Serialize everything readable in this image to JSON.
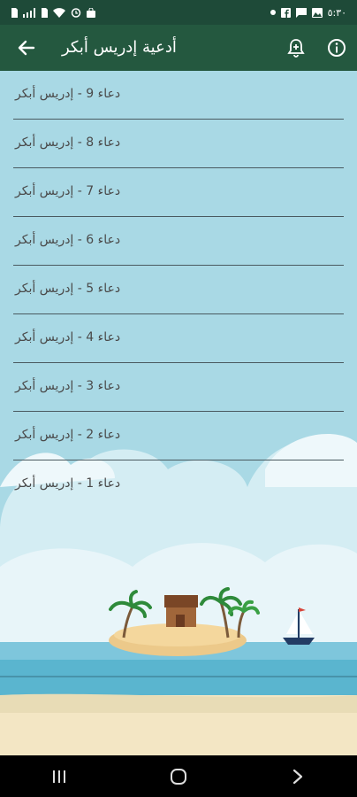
{
  "status_bar": {
    "time": "٥:٣٠",
    "left_icons": [
      "sim-icon",
      "signal-icon",
      "sim-icon",
      "wifi-icon",
      "alarm-icon",
      "shopping-icon"
    ],
    "right_icons": [
      "dot-icon",
      "facebook-icon",
      "message-icon",
      "image-icon"
    ]
  },
  "app_bar": {
    "title": "أدعية إدريس أبكر",
    "back_icon": "arrow-left-icon",
    "notification_icon": "bell-add-icon",
    "info_icon": "info-icon"
  },
  "duas": [
    {
      "label": "دعاء 9 - إدريس أبكر"
    },
    {
      "label": "دعاء 8 - إدريس أبكر"
    },
    {
      "label": "دعاء 7 - إدريس أبكر"
    },
    {
      "label": "دعاء 6 - إدريس أبكر"
    },
    {
      "label": "دعاء 5 - إدريس أبكر"
    },
    {
      "label": "دعاء 4 - إدريس أبكر"
    },
    {
      "label": "دعاء 3 - إدريس أبكر"
    },
    {
      "label": "دعاء 2 - إدريس أبكر"
    },
    {
      "label": "دعاء 1 - إدريس أبكر"
    }
  ],
  "nav_bar": {
    "buttons": [
      "recents-icon",
      "home-icon",
      "back-icon"
    ]
  },
  "colors": {
    "header": "#24583f",
    "status_bar": "#1e4a38",
    "sky": "#a9d9e5",
    "sea": "#5ab5cf",
    "sand": "#f3e6c4"
  }
}
